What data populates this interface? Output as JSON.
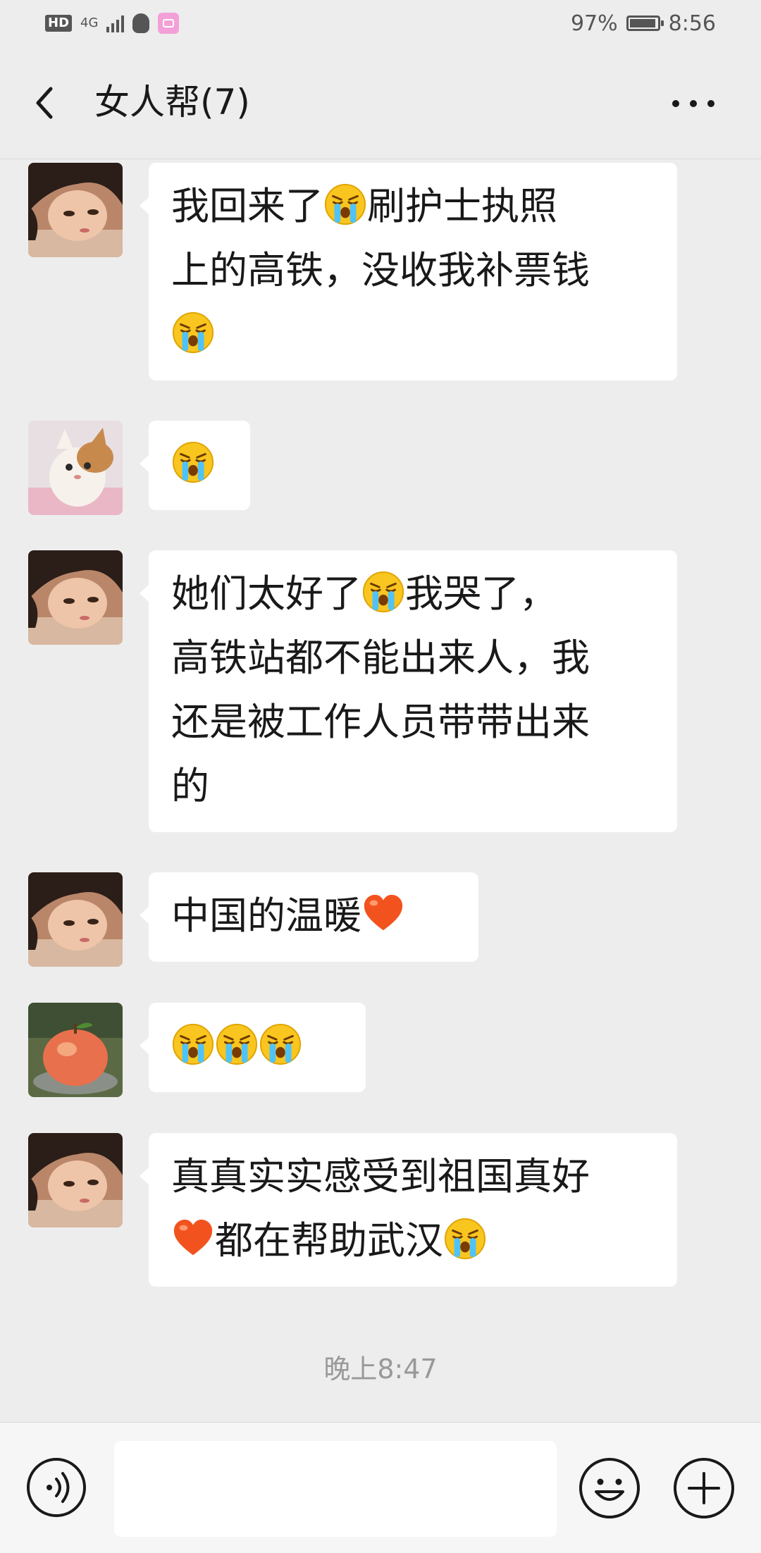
{
  "status_bar": {
    "hd_badge": "HD",
    "network": "4G",
    "battery_percent": "97%",
    "battery_level": 0.97,
    "time": "8:56"
  },
  "header": {
    "title": "女人帮(7)"
  },
  "messages": [
    {
      "sender_avatar": "girl-avatar",
      "parts": [
        {
          "t": "我回来了"
        },
        {
          "e": "crying-emoji"
        },
        {
          "t": "刷护士执照"
        },
        {
          "br": true
        },
        {
          "t": "上的高铁，没收我补票钱"
        },
        {
          "br": true
        },
        {
          "e": "crying-emoji"
        }
      ]
    },
    {
      "sender_avatar": "cat-avatar",
      "parts": [
        {
          "e": "crying-emoji"
        }
      ]
    },
    {
      "sender_avatar": "girl-avatar",
      "parts": [
        {
          "t": "她们太好了"
        },
        {
          "e": "crying-emoji"
        },
        {
          "t": "我哭了，"
        },
        {
          "br": true
        },
        {
          "t": "高铁站都不能出来人，我"
        },
        {
          "br": true
        },
        {
          "t": "还是被工作人员带带出来"
        },
        {
          "br": true
        },
        {
          "t": "的"
        }
      ]
    },
    {
      "sender_avatar": "girl-avatar",
      "parts": [
        {
          "t": "中国的温暖"
        },
        {
          "e": "heart-emoji"
        }
      ]
    },
    {
      "sender_avatar": "apple-avatar",
      "parts": [
        {
          "e": "crying-emoji"
        },
        {
          "e": "crying-emoji"
        },
        {
          "e": "crying-emoji"
        }
      ]
    },
    {
      "sender_avatar": "girl-avatar",
      "parts": [
        {
          "t": "真真实实感受到祖国真好"
        },
        {
          "br": true
        },
        {
          "e": "heart-emoji"
        },
        {
          "t": "都在帮助武汉"
        },
        {
          "e": "crying-emoji"
        }
      ]
    }
  ],
  "timestamp": "晚上8:47",
  "input": {
    "value": "",
    "placeholder": ""
  },
  "icons": {
    "back": "back-arrow-icon",
    "more": "more-icon",
    "voice": "voice-icon",
    "emoji": "emoji-icon",
    "plus": "plus-icon"
  }
}
